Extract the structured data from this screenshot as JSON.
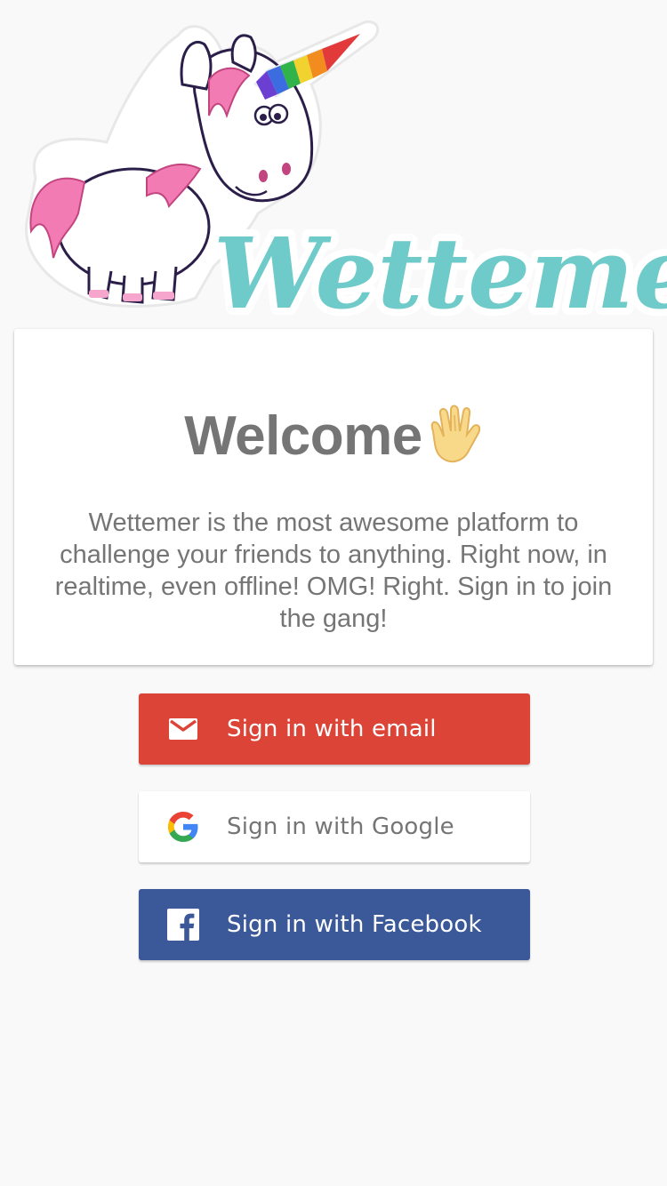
{
  "header": {
    "logo_text": "Wettemer?",
    "logo_color": "#6ecbc9"
  },
  "card": {
    "title": "Welcome",
    "title_icon": "vulcan-salute-hand-icon",
    "text": "Wettemer is the most awesome platform to challenge your friends to anything. Right now, in realtime, even offline! OMG! Right. Sign in to join the gang!"
  },
  "auth": {
    "buttons": [
      {
        "label": "Sign in with email",
        "icon": "mail-icon",
        "color": "#db4437"
      },
      {
        "label": "Sign in with Google",
        "icon": "google-icon",
        "color": "#ffffff"
      },
      {
        "label": "Sign in with Facebook",
        "icon": "facebook-icon",
        "color": "#3b5998"
      }
    ]
  },
  "colors": {
    "background": "#f9f9f9",
    "text_gray": "#757575"
  }
}
